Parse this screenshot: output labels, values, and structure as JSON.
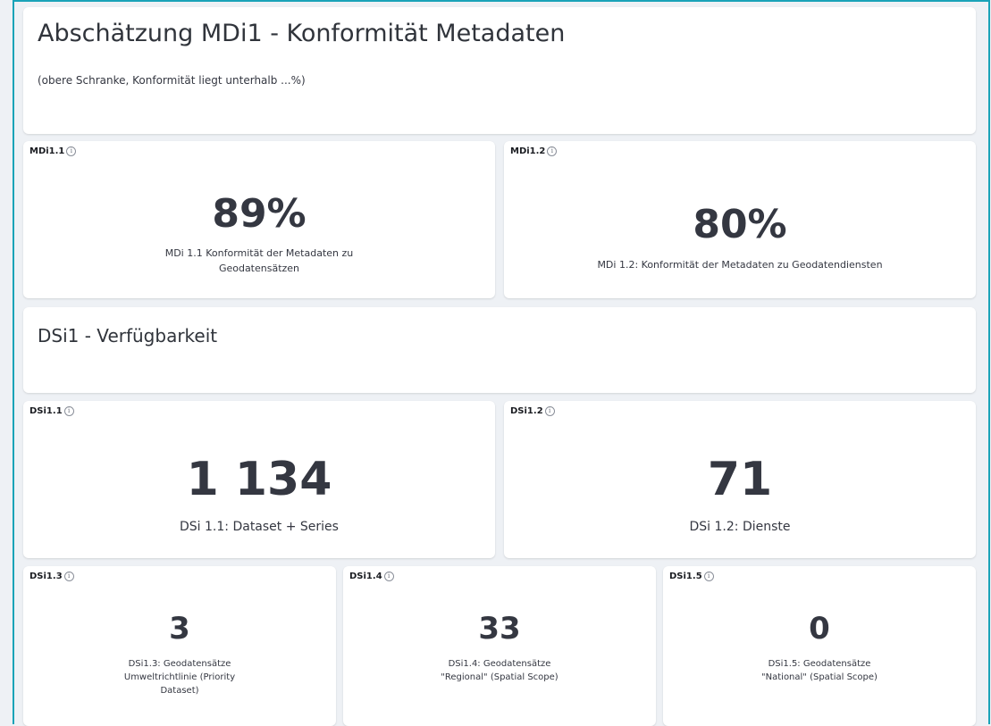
{
  "sections": {
    "mdi": {
      "title": "Abschätzung MDi1 - Konformität Metadaten",
      "subtitle": "(obere Schranke, Konformität liegt unterhalb ...%)"
    },
    "dsi": {
      "title": "DSi1 - Verfügbarkeit"
    }
  },
  "panels": {
    "mdi11": {
      "label": "MDi1.1",
      "value": "89%",
      "desc": "MDi 1.1 Konformität der Metadaten zu Geodatensätzen"
    },
    "mdi12": {
      "label": "MDi1.2",
      "value": "80%",
      "desc": "MDi 1.2: Konformität der Metadaten zu Geodatendiensten"
    },
    "dsi11": {
      "label": "DSi1.1",
      "value": "1 134",
      "desc": "DSi 1.1: Dataset + Series"
    },
    "dsi12": {
      "label": "DSi1.2",
      "value": "71",
      "desc": "DSi 1.2: Dienste"
    },
    "dsi13": {
      "label": "DSi1.3",
      "value": "3",
      "desc": "DSi1.3: Geodatensätze Umweltrichtlinie (Priority Dataset)"
    },
    "dsi14": {
      "label": "DSi1.4",
      "value": "33",
      "desc": "DSi1.4: Geodatensätze \"Regional\" (Spatial Scope)"
    },
    "dsi15": {
      "label": "DSi1.5",
      "value": "0",
      "desc": "DSi1.5: Geodatensätze \"National\" (Spatial Scope)"
    }
  },
  "icons": {
    "info": "info-icon"
  },
  "colors": {
    "frame": "#1aa3b8",
    "background": "#eef1f5",
    "panel": "#ffffff",
    "text": "#343741"
  }
}
